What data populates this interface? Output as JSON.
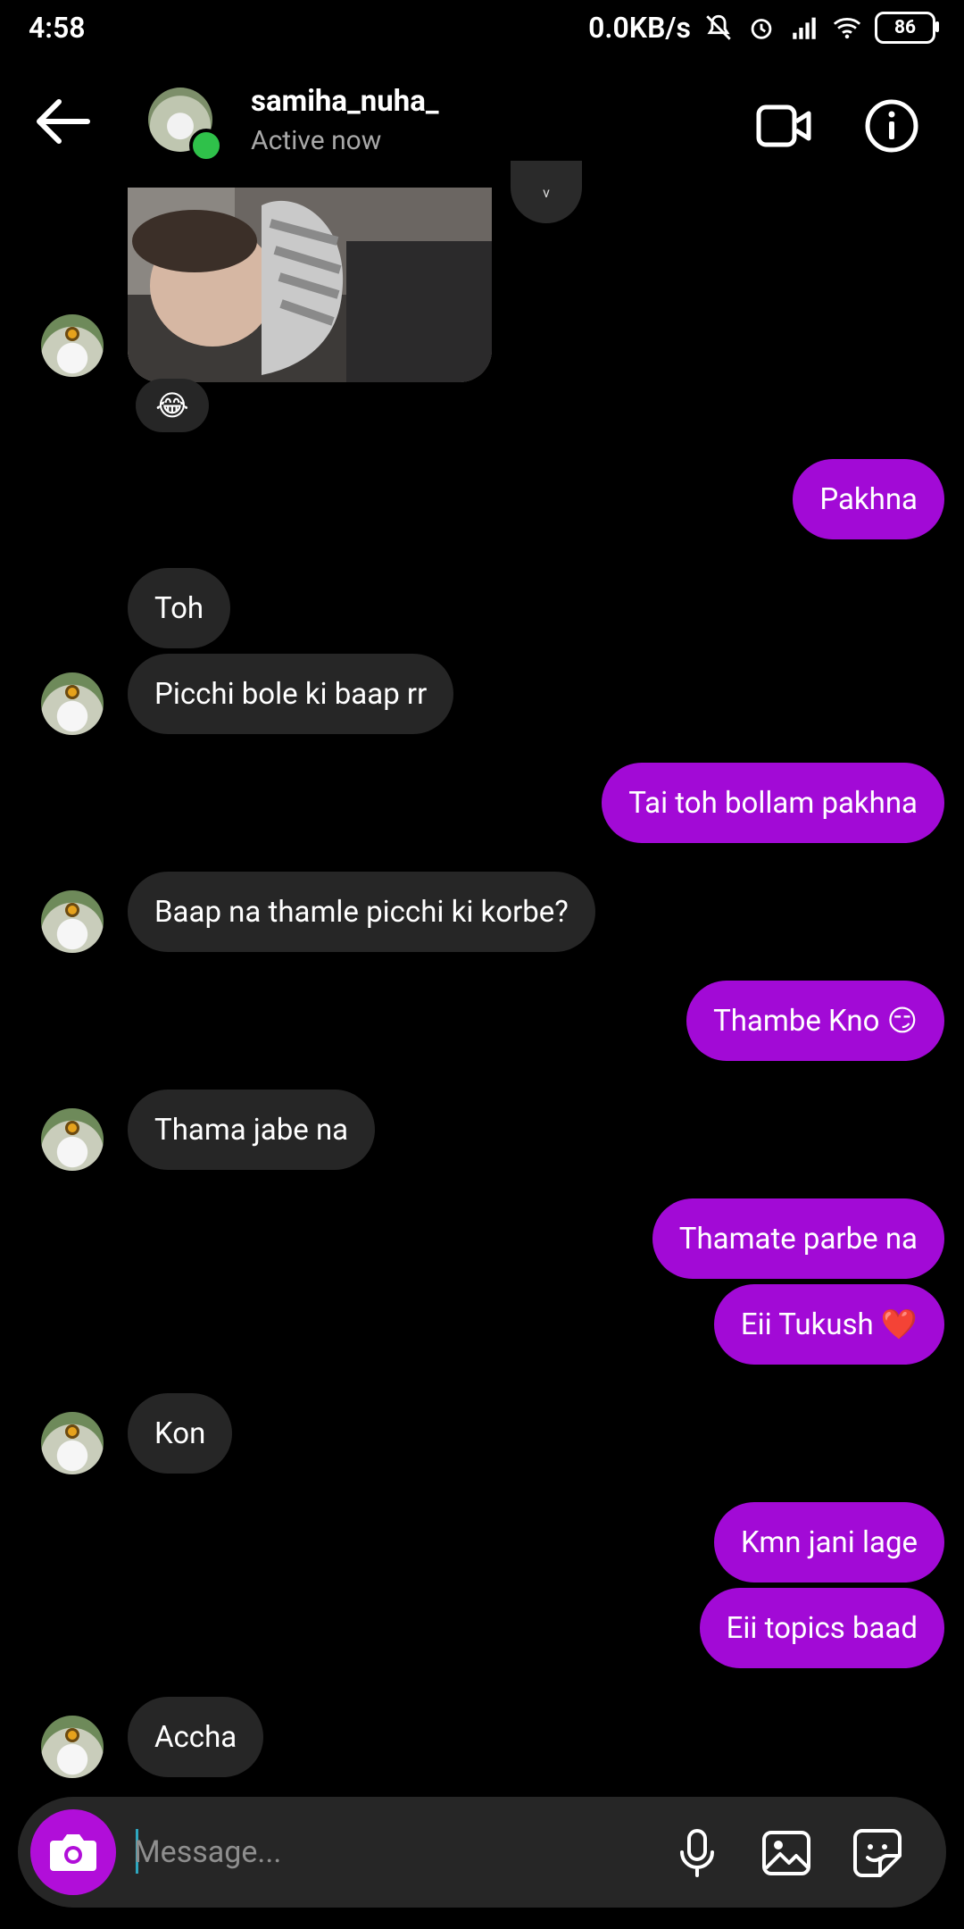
{
  "status_bar": {
    "time": "4:58",
    "net_speed": "0.0KB/s",
    "battery": "86"
  },
  "header": {
    "username": "samiha_nuha_",
    "presence": "Active now",
    "back_icon": "arrow-left-icon",
    "video_icon": "video-camera-icon",
    "info_icon": "info-icon",
    "online_color": "#2fc14a"
  },
  "photo": {
    "reaction": "😂",
    "more_chip": "v"
  },
  "messages": {
    "m1": "Pakhna",
    "m2": "Toh",
    "m3": "Picchi bole ki baap rr",
    "m4": "Tai toh bollam pakhna",
    "m5": "Baap na thamle picchi ki korbe?",
    "m6": "Thambe Kno 😏",
    "m7": "Thama jabe na",
    "m8": "Thamate parbe na",
    "m9": "Eii Tukush ❤️",
    "m10": "Kon",
    "m11": "Kmn jani lage",
    "m12": "Eii topics baad",
    "m13": "Accha"
  },
  "composer": {
    "placeholder": "Message...",
    "camera_icon": "camera-icon",
    "mic_icon": "microphone-icon",
    "gallery_icon": "image-icon",
    "sticker_icon": "sticker-icon"
  },
  "colors": {
    "outgoing": "#a20ad6",
    "incoming": "#262626",
    "background": "#000000",
    "accent": "#b10ed9"
  }
}
